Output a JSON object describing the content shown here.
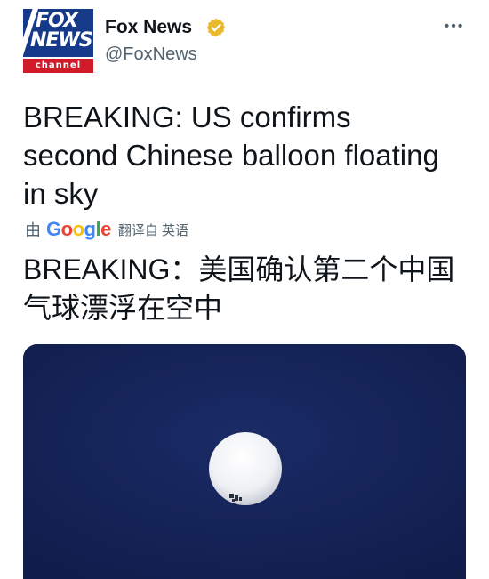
{
  "account": {
    "logo_line1": "FOX",
    "logo_line2": "NEWS",
    "logo_sub": "channel",
    "name": "Fox News",
    "handle": "@FoxNews",
    "verified_icon": "verified-badge-icon",
    "verified_color": "#e8b92b"
  },
  "menu": {
    "more_label": "•••"
  },
  "tweet": {
    "text": "BREAKING: US confirms second Chinese balloon floating in sky"
  },
  "translation": {
    "prefix": "由",
    "provider": "Google",
    "suffix": "翻译自 英语",
    "text": "BREAKING：美国确认第二个中国气球漂浮在空中"
  },
  "media": {
    "type": "image",
    "colors": {
      "sky": "#15245a",
      "balloon": "#f2f2f2"
    }
  }
}
